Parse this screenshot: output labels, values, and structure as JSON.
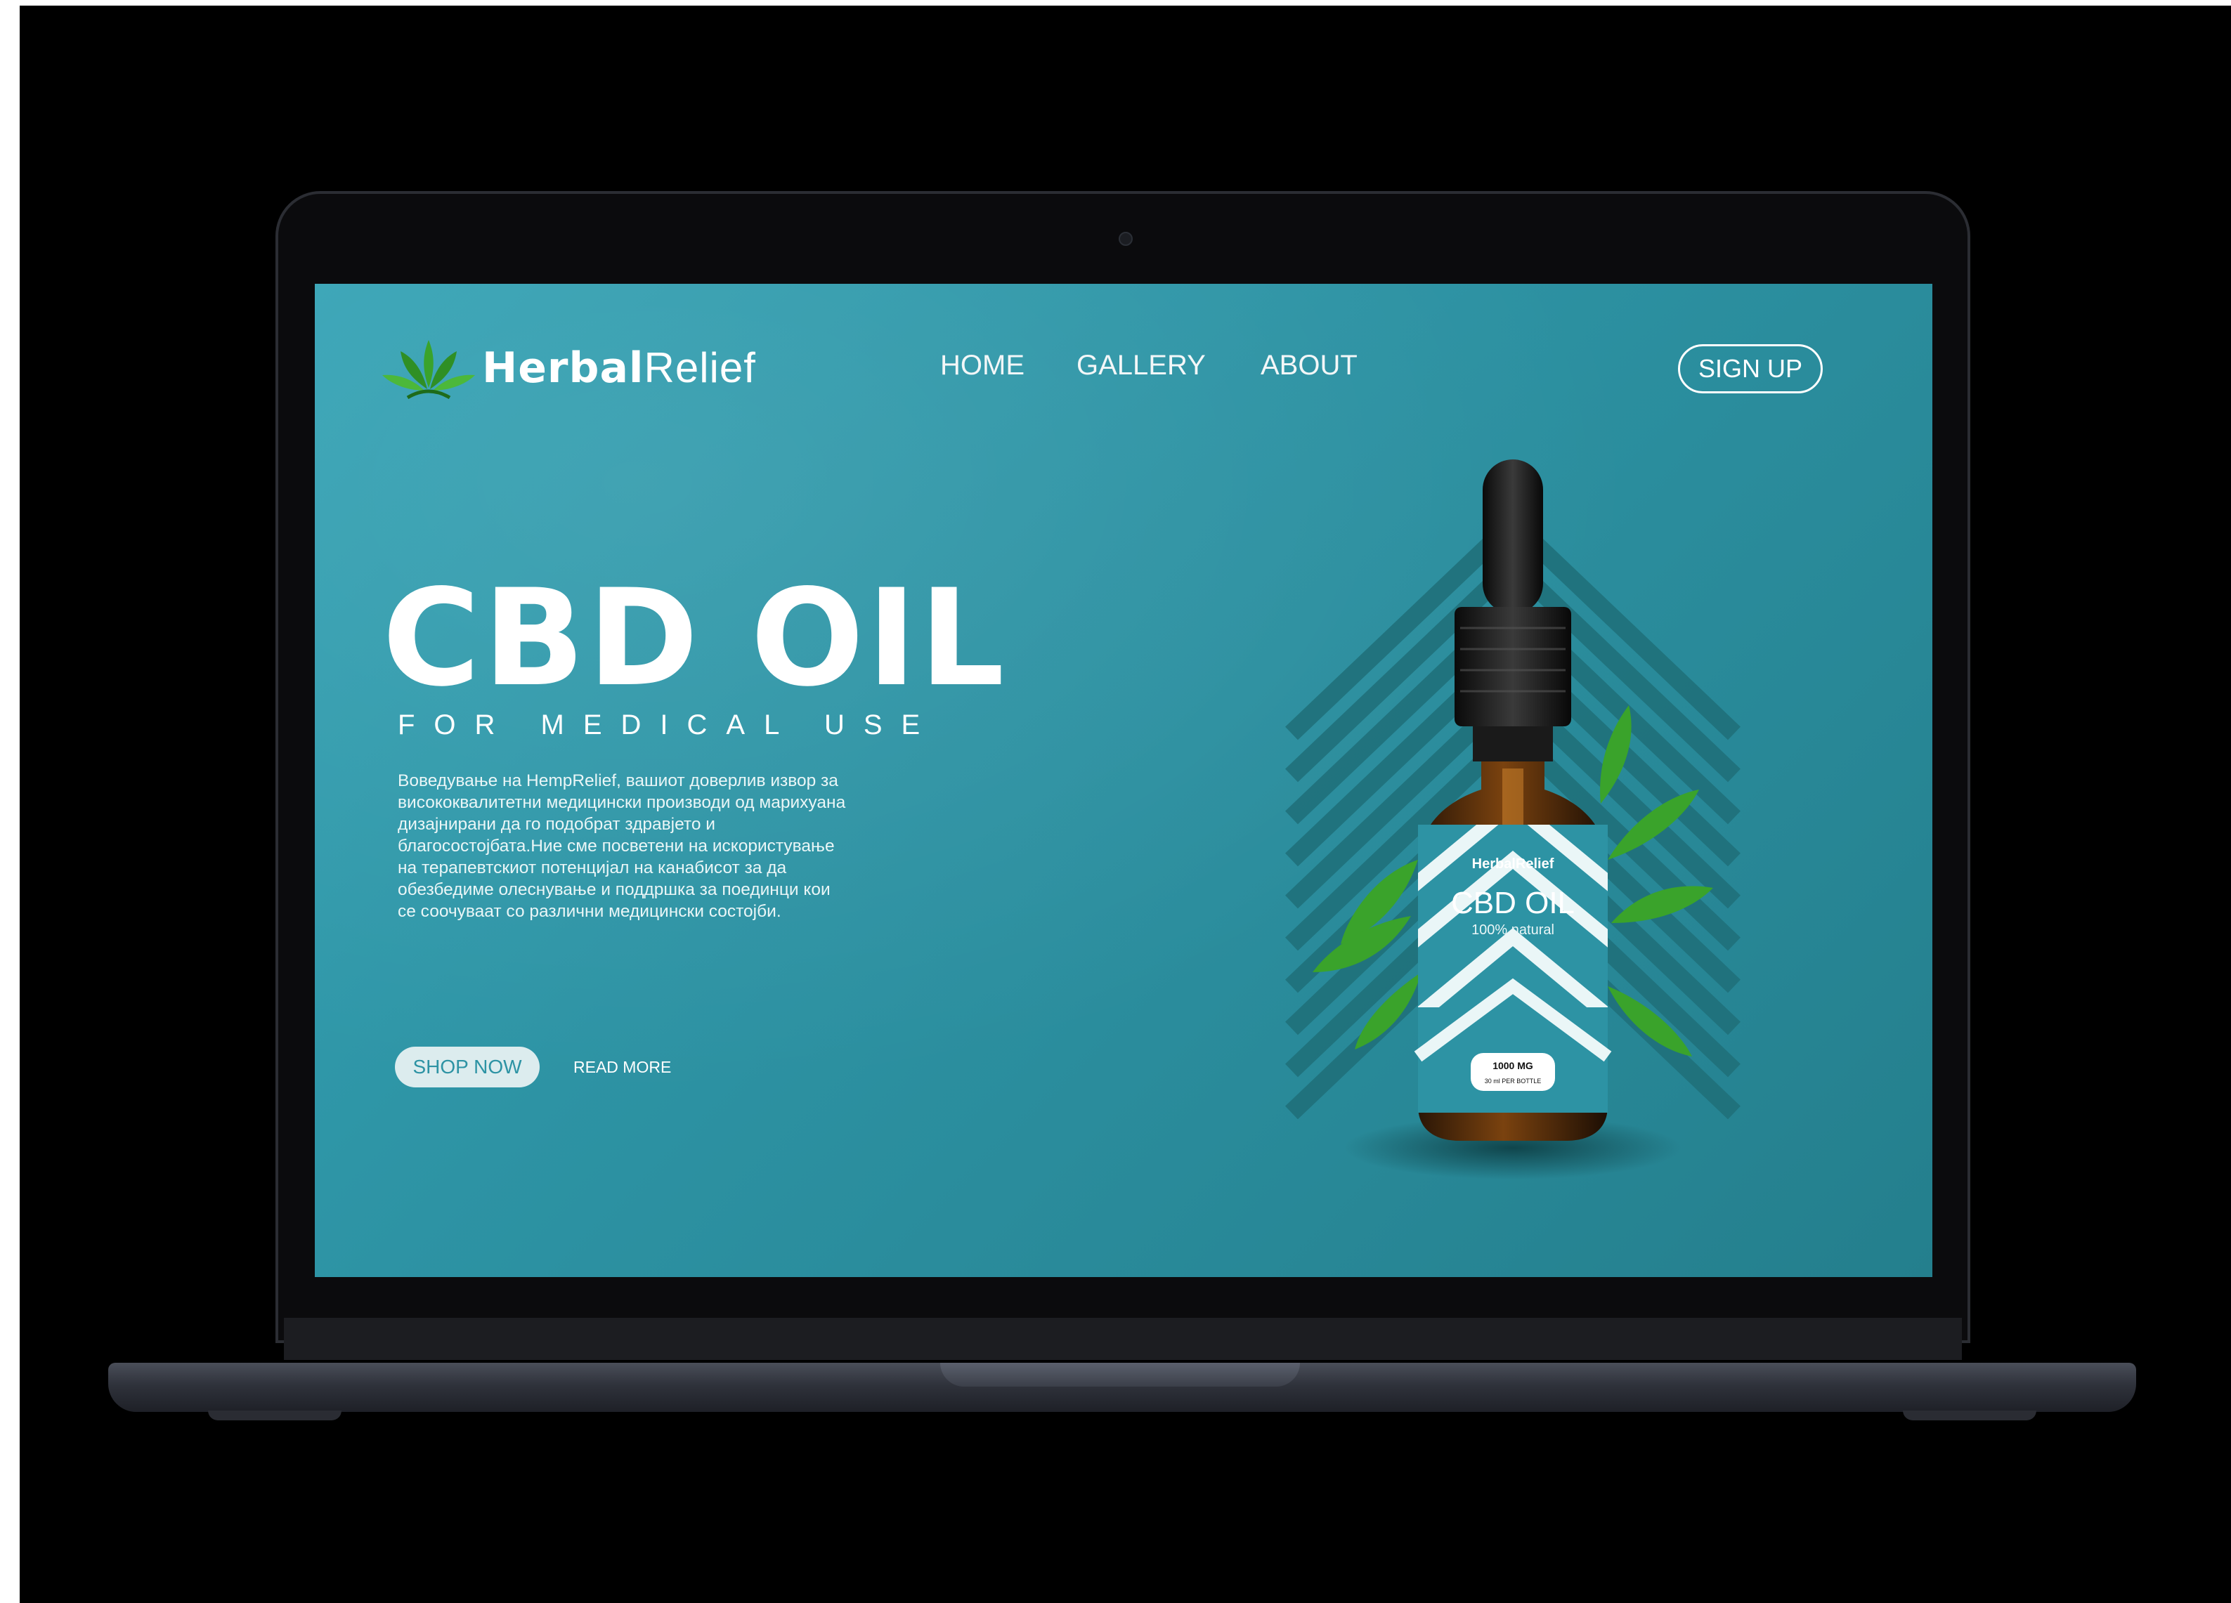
{
  "brand": {
    "bold": "Herbal",
    "light": "Relief"
  },
  "nav": [
    {
      "label": "HOME"
    },
    {
      "label": "GALLERY"
    },
    {
      "label": "ABOUT"
    }
  ],
  "signup_label": "SIGN UP",
  "hero": {
    "title": "CBD OIL",
    "subtitle": "FOR MEDICAL USE",
    "description": "Воведување на HempRelief, вашиот доверлив извор за висококвалитетни медицински производи од марихуана дизајнирани да го подобрат здравјето и благосостојбата.Ние сме посветени на искористување на терапевтскиот потенцијал на канабисот за да обезбедиме олеснување и поддршка за поединци кои се соочуваат со различни медицински состојби."
  },
  "buttons": {
    "shop_now": "SHOP NOW",
    "read_more": "READ MORE"
  },
  "product": {
    "label_brand": "HerbalRelief",
    "label_title": "CBD OIL",
    "label_tag": "100% natural",
    "dose": "1000 MG",
    "volume": "30 ml PER BOTTLE"
  },
  "colors": {
    "screen_teal": "#2d93a4",
    "leaf_green": "#3aa32b",
    "chevron_dark": "#1f6f79"
  }
}
